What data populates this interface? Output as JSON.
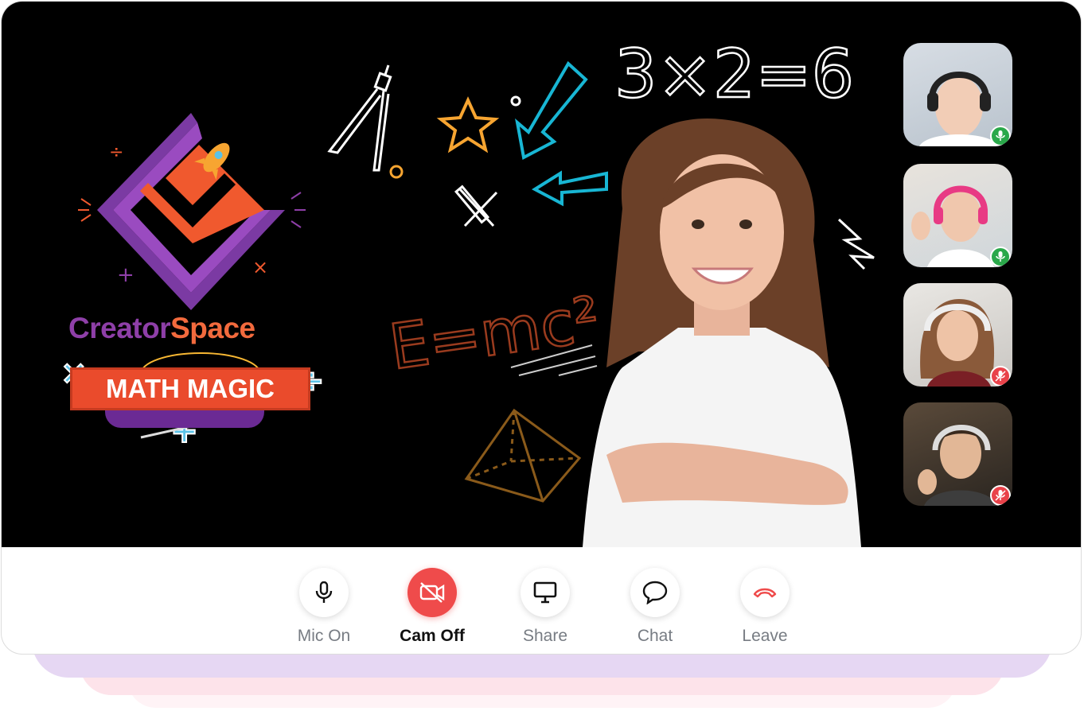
{
  "brand": {
    "name_part1": "Creator",
    "name_part2": "Space",
    "banner": "MATH MAGIC"
  },
  "board": {
    "equation1": "3×2=6",
    "equation2": "E=mc²"
  },
  "participants": [
    {
      "name_icon": "participant-1-video",
      "mic": "on"
    },
    {
      "name_icon": "participant-2-video",
      "mic": "on"
    },
    {
      "name_icon": "participant-3-video",
      "mic": "muted"
    },
    {
      "name_icon": "participant-4-video",
      "mic": "muted"
    }
  ],
  "controls": {
    "mic_label": "Mic On",
    "cam_label": "Cam Off",
    "share_label": "Share",
    "chat_label": "Chat",
    "leave_label": "Leave"
  },
  "colors": {
    "accent_red": "#ef4b4b",
    "mic_on": "#2aa84a",
    "mic_off": "#e9424a",
    "brand_purple": "#8e3fa8",
    "brand_orange": "#f26a3d"
  }
}
